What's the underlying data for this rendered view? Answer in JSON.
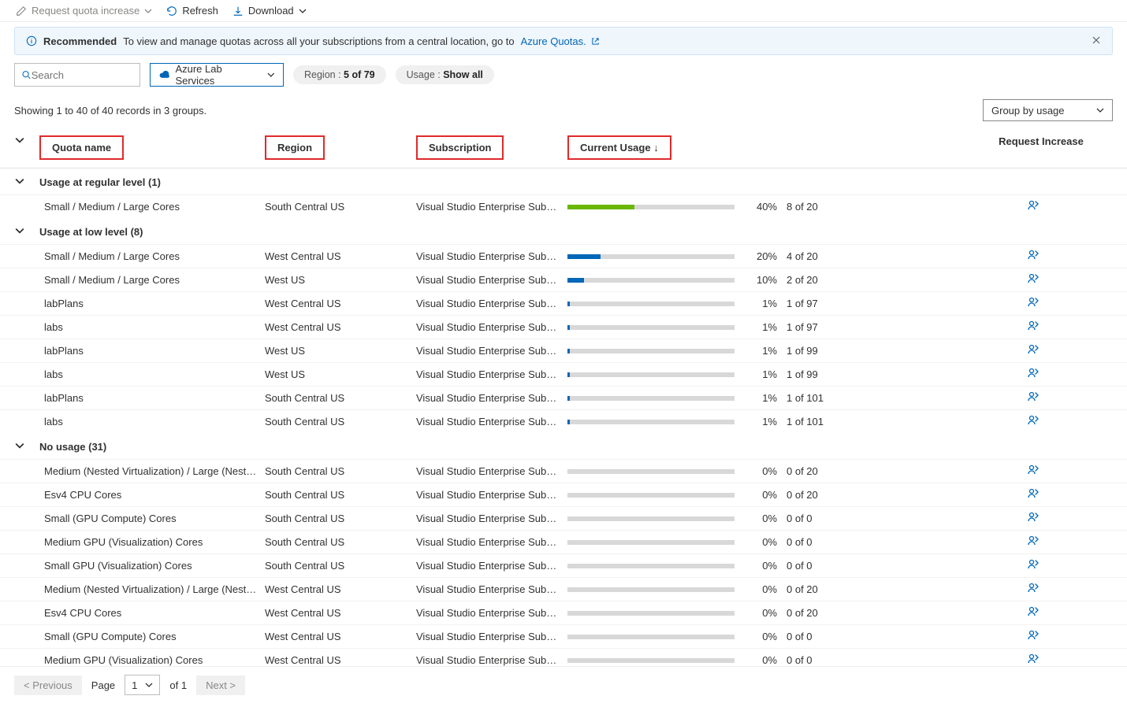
{
  "toolbar": {
    "request_increase": "Request quota increase",
    "refresh": "Refresh",
    "download": "Download"
  },
  "banner": {
    "label": "Recommended",
    "text": "To view and manage quotas across all your subscriptions from a central location, go to ",
    "link": "Azure Quotas."
  },
  "filters": {
    "search_placeholder": "Search",
    "provider": "Azure Lab Services",
    "region_label": "Region : ",
    "region_value": "5 of 79",
    "usage_label": "Usage : ",
    "usage_value": "Show all"
  },
  "status": "Showing 1 to 40 of 40 records in 3 groups.",
  "group_by": "Group by usage",
  "columns": {
    "quota": "Quota name",
    "region": "Region",
    "subscription": "Subscription",
    "usage": "Current Usage",
    "request": "Request Increase"
  },
  "groups": [
    {
      "title": "Usage at regular level (1)",
      "rows": [
        {
          "quota": "Small / Medium / Large Cores",
          "region": "South Central US",
          "sub": "Visual Studio Enterprise Subscri...",
          "pct": 40,
          "pct_label": "40%",
          "ratio": "8 of 20",
          "color": "green"
        }
      ]
    },
    {
      "title": "Usage at low level (8)",
      "rows": [
        {
          "quota": "Small / Medium / Large Cores",
          "region": "West Central US",
          "sub": "Visual Studio Enterprise Subscri...",
          "pct": 20,
          "pct_label": "20%",
          "ratio": "4 of 20",
          "color": "blue"
        },
        {
          "quota": "Small / Medium / Large Cores",
          "region": "West US",
          "sub": "Visual Studio Enterprise Subscri...",
          "pct": 10,
          "pct_label": "10%",
          "ratio": "2 of 20",
          "color": "blue"
        },
        {
          "quota": "labPlans",
          "region": "West Central US",
          "sub": "Visual Studio Enterprise Subscri...",
          "pct": 1,
          "pct_label": "1%",
          "ratio": "1 of 97",
          "color": "blue"
        },
        {
          "quota": "labs",
          "region": "West Central US",
          "sub": "Visual Studio Enterprise Subscri...",
          "pct": 1,
          "pct_label": "1%",
          "ratio": "1 of 97",
          "color": "blue"
        },
        {
          "quota": "labPlans",
          "region": "West US",
          "sub": "Visual Studio Enterprise Subscri...",
          "pct": 1,
          "pct_label": "1%",
          "ratio": "1 of 99",
          "color": "blue"
        },
        {
          "quota": "labs",
          "region": "West US",
          "sub": "Visual Studio Enterprise Subscri...",
          "pct": 1,
          "pct_label": "1%",
          "ratio": "1 of 99",
          "color": "blue"
        },
        {
          "quota": "labPlans",
          "region": "South Central US",
          "sub": "Visual Studio Enterprise Subscri...",
          "pct": 1,
          "pct_label": "1%",
          "ratio": "1 of 101",
          "color": "blue"
        },
        {
          "quota": "labs",
          "region": "South Central US",
          "sub": "Visual Studio Enterprise Subscri...",
          "pct": 1,
          "pct_label": "1%",
          "ratio": "1 of 101",
          "color": "blue"
        }
      ]
    },
    {
      "title": "No usage (31)",
      "rows": [
        {
          "quota": "Medium (Nested Virtualization) / Large (Nested ...",
          "region": "South Central US",
          "sub": "Visual Studio Enterprise Subscri...",
          "pct": 0,
          "pct_label": "0%",
          "ratio": "0 of 20",
          "color": "blue"
        },
        {
          "quota": "Esv4 CPU Cores",
          "region": "South Central US",
          "sub": "Visual Studio Enterprise Subscri...",
          "pct": 0,
          "pct_label": "0%",
          "ratio": "0 of 20",
          "color": "blue"
        },
        {
          "quota": "Small (GPU Compute) Cores",
          "region": "South Central US",
          "sub": "Visual Studio Enterprise Subscri...",
          "pct": 0,
          "pct_label": "0%",
          "ratio": "0 of 0",
          "color": "blue"
        },
        {
          "quota": "Medium GPU (Visualization) Cores",
          "region": "South Central US",
          "sub": "Visual Studio Enterprise Subscri...",
          "pct": 0,
          "pct_label": "0%",
          "ratio": "0 of 0",
          "color": "blue"
        },
        {
          "quota": "Small GPU (Visualization) Cores",
          "region": "South Central US",
          "sub": "Visual Studio Enterprise Subscri...",
          "pct": 0,
          "pct_label": "0%",
          "ratio": "0 of 0",
          "color": "blue"
        },
        {
          "quota": "Medium (Nested Virtualization) / Large (Nested ...",
          "region": "West Central US",
          "sub": "Visual Studio Enterprise Subscri...",
          "pct": 0,
          "pct_label": "0%",
          "ratio": "0 of 20",
          "color": "blue"
        },
        {
          "quota": "Esv4 CPU Cores",
          "region": "West Central US",
          "sub": "Visual Studio Enterprise Subscri...",
          "pct": 0,
          "pct_label": "0%",
          "ratio": "0 of 20",
          "color": "blue"
        },
        {
          "quota": "Small (GPU Compute) Cores",
          "region": "West Central US",
          "sub": "Visual Studio Enterprise Subscri...",
          "pct": 0,
          "pct_label": "0%",
          "ratio": "0 of 0",
          "color": "blue"
        },
        {
          "quota": "Medium GPU (Visualization) Cores",
          "region": "West Central US",
          "sub": "Visual Studio Enterprise Subscri...",
          "pct": 0,
          "pct_label": "0%",
          "ratio": "0 of 0",
          "color": "blue"
        }
      ]
    }
  ],
  "pager": {
    "prev": "< Previous",
    "page_label": "Page",
    "page_value": "1",
    "of_label": "of 1",
    "next": "Next >"
  }
}
